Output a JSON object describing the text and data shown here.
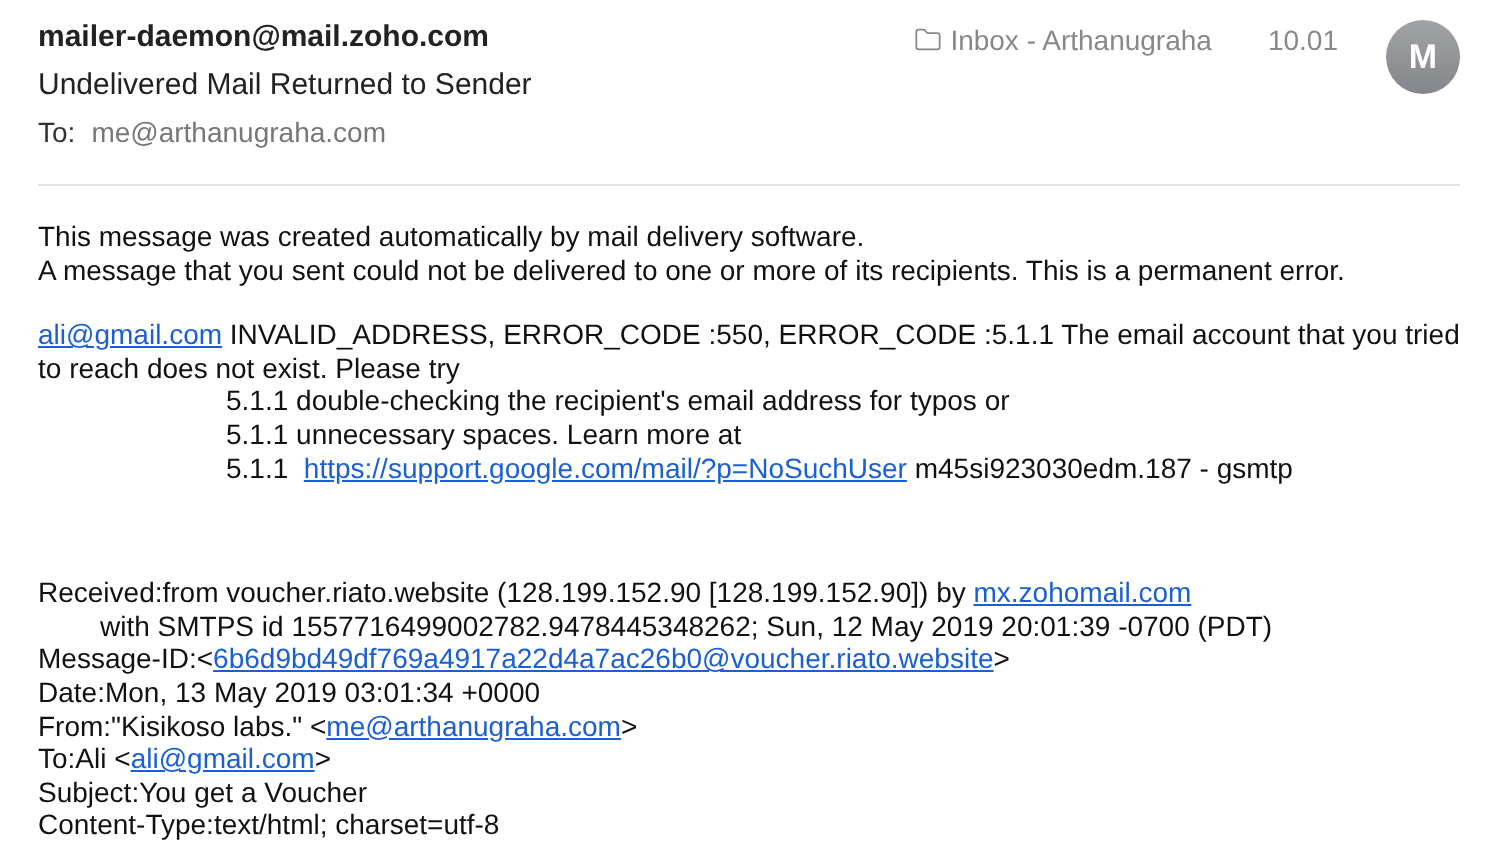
{
  "header": {
    "sender": "mailer-daemon@mail.zoho.com",
    "subject": "Undelivered Mail Returned to Sender",
    "to_label": "To:",
    "to": "me@arthanugraha.com",
    "folder": "Inbox - Arthanugraha",
    "time": "10.01",
    "avatar": "M"
  },
  "body": [
    {
      "kind": "notice",
      "lines": [
        {
          "kind": "plain",
          "segments": [
            {
              "kind": "text",
              "text": "This message was created automatically by mail delivery software."
            }
          ]
        },
        {
          "kind": "plain",
          "segments": [
            {
              "kind": "text",
              "text": "A message that you sent could not be delivered to one or more of its recipients. This is a permanent error."
            }
          ]
        }
      ]
    },
    {
      "kind": "notice",
      "lines": [
        {
          "kind": "plain",
          "segments": [
            {
              "kind": "link",
              "text": "ali@gmail.com"
            },
            {
              "kind": "text",
              "text": " INVALID_ADDRESS, ERROR_CODE :550, ERROR_CODE :5.1.1 The email account that you tried to reach does not exist. Please try"
            }
          ]
        },
        {
          "kind": "deep",
          "segments": [
            {
              "kind": "text",
              "text": "5.1.1 double-checking the recipient's email address for typos or"
            }
          ]
        },
        {
          "kind": "deep",
          "segments": [
            {
              "kind": "text",
              "text": "5.1.1 unnecessary spaces. Learn more at"
            }
          ]
        },
        {
          "kind": "deep",
          "segments": [
            {
              "kind": "text",
              "text": "5.1.1  "
            },
            {
              "kind": "link",
              "text": "https://support.google.com/mail/?p=NoSuchUser"
            },
            {
              "kind": "text",
              "text": " m45si923030edm.187 - gsmtp"
            }
          ]
        }
      ]
    },
    {
      "kind": "headers",
      "lines": [
        {
          "kind": "plain",
          "segments": [
            {
              "kind": "text",
              "text": "Received:from voucher.riato.website (128.199.152.90 [128.199.152.90]) by "
            },
            {
              "kind": "link",
              "text": "mx.zohomail.com"
            }
          ]
        },
        {
          "kind": "indent",
          "segments": [
            {
              "kind": "text",
              "text": "with SMTPS id 1557716499002782.9478445348262; Sun, 12 May 2019 20:01:39 -0700 (PDT)"
            }
          ]
        },
        {
          "kind": "plain",
          "segments": [
            {
              "kind": "text",
              "text": "Message-ID:<"
            },
            {
              "kind": "link",
              "text": "6b6d9bd49df769a4917a22d4a7ac26b0@voucher.riato.website"
            },
            {
              "kind": "text",
              "text": ">"
            }
          ]
        },
        {
          "kind": "plain",
          "segments": [
            {
              "kind": "text",
              "text": "Date:Mon, 13 May 2019 03:01:34 +0000"
            }
          ]
        },
        {
          "kind": "plain",
          "segments": [
            {
              "kind": "text",
              "text": "From:\"Kisikoso labs.\" <"
            },
            {
              "kind": "link",
              "text": "me@arthanugraha.com"
            },
            {
              "kind": "text",
              "text": ">"
            }
          ]
        },
        {
          "kind": "plain",
          "segments": [
            {
              "kind": "text",
              "text": "To:Ali <"
            },
            {
              "kind": "link",
              "text": "ali@gmail.com"
            },
            {
              "kind": "text",
              "text": ">"
            }
          ]
        },
        {
          "kind": "plain",
          "segments": [
            {
              "kind": "text",
              "text": "Subject:You get a Voucher"
            }
          ]
        },
        {
          "kind": "plain",
          "segments": [
            {
              "kind": "text",
              "text": "Content-Type:text/html; charset=utf-8"
            }
          ]
        }
      ]
    }
  ]
}
